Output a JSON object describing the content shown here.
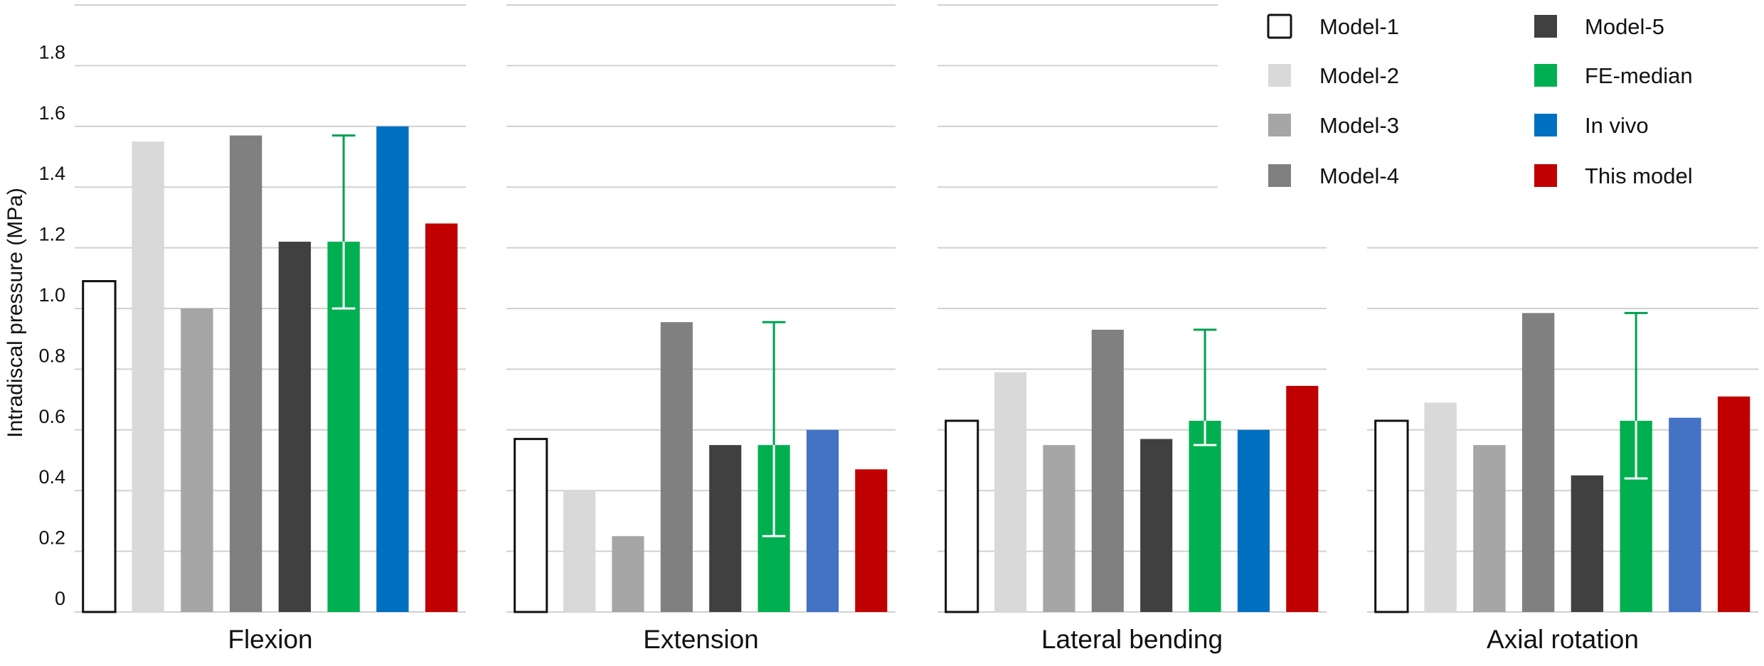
{
  "chart_data": {
    "type": "bar",
    "title": "",
    "xlabel": "",
    "ylabel": "Intradiscal pressure (MPa)",
    "ylim": [
      0,
      2.0
    ],
    "yticks": [
      0,
      0.2,
      0.4,
      0.6,
      0.8,
      1.0,
      1.2,
      1.4,
      1.6,
      1.8
    ],
    "ytick_labels": [
      "0",
      "0.2",
      "0.4",
      "0.6",
      "0.8",
      "1.0",
      "1.2",
      "1.4",
      "1.6",
      "1.8"
    ],
    "grid": true,
    "legend_position": "top-right",
    "categories": [
      "Flexion",
      "Extension",
      "Lateral bending",
      "Axial rotation"
    ],
    "series": [
      {
        "name": "Model-1",
        "color": "#ffffff",
        "outline": "#111111",
        "values": [
          1.09,
          0.57,
          0.63,
          0.63
        ]
      },
      {
        "name": "Model-2",
        "color": "#d9d9d9",
        "values": [
          1.55,
          0.4,
          0.79,
          0.69
        ]
      },
      {
        "name": "Model-3",
        "color": "#a6a6a6",
        "values": [
          1.0,
          0.25,
          0.55,
          0.55
        ]
      },
      {
        "name": "Model-4",
        "color": "#808080",
        "values": [
          1.57,
          0.955,
          0.93,
          0.985
        ]
      },
      {
        "name": "Model-5",
        "color": "#404040",
        "values": [
          1.22,
          0.55,
          0.57,
          0.45
        ]
      },
      {
        "name": "FE-median",
        "color": "#00b050",
        "values": [
          1.22,
          0.55,
          0.63,
          0.63
        ],
        "error_low": [
          1.0,
          0.25,
          0.55,
          0.44
        ],
        "error_high": [
          1.57,
          0.955,
          0.93,
          0.985
        ]
      },
      {
        "name": "In vivo",
        "color": "#0070c0",
        "colors_per_category": [
          "#0070c0",
          "#4472c4",
          "#0070c0",
          "#4472c4"
        ],
        "values": [
          1.6,
          0.6,
          0.6,
          0.64
        ]
      },
      {
        "name": "This model",
        "color": "#c00000",
        "values": [
          1.28,
          0.47,
          0.745,
          0.71
        ]
      }
    ],
    "legend_columns": [
      [
        "Model-1",
        "Model-2",
        "Model-3",
        "Model-4"
      ],
      [
        "Model-5",
        "FE-median",
        "In vivo",
        "This model"
      ]
    ],
    "error_bar_color": "#00a050"
  }
}
